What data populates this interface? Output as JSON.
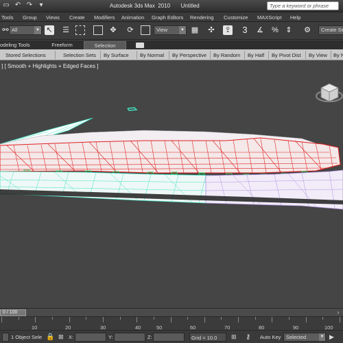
{
  "titlebar": {
    "title": "Autodesk 3ds Max  2010       Untitled",
    "search_placeholder": "Type a keyword or phrase"
  },
  "menu": {
    "items": [
      "Tools",
      "Group",
      "Views",
      "Create",
      "Modifiers",
      "Animation",
      "Graph Editors",
      "Rendering",
      "Customize",
      "MAXScript",
      "Help"
    ]
  },
  "toolbar": {
    "selection_filter": "All",
    "reference_coord": "View",
    "snap_value": "3",
    "named_selection": "Create Se"
  },
  "ribbon": {
    "tabs": [
      "odeling Tools",
      "Freeform",
      "Selection"
    ],
    "panel_items": [
      "Stored Selections",
      "Selection Sets",
      "By Surface",
      "By Normal",
      "By Perspective",
      "By Random",
      "By Half",
      "By Pivot Dist",
      "By View",
      "By Nume"
    ]
  },
  "viewport": {
    "label": "] [ Smooth + Highlights + Edged Faces ]"
  },
  "timeline": {
    "slider": "0 / 100",
    "ticks": [
      "10",
      "20",
      "30",
      "40",
      "50",
      "60",
      "70",
      "80",
      "90",
      "100"
    ]
  },
  "status": {
    "selection_count": "1 Object Sele",
    "x_label": "X:",
    "y_label": "Y:",
    "z_label": "Z:",
    "grid": "Grid = 10.0",
    "autokey": "Auto Key",
    "key_mode": "Selected"
  },
  "colors": {
    "wire_red": "#e02020",
    "wire_cyan": "#40e0c0",
    "wire_purple": "#b090e0",
    "viewport_bg": "#454545"
  }
}
